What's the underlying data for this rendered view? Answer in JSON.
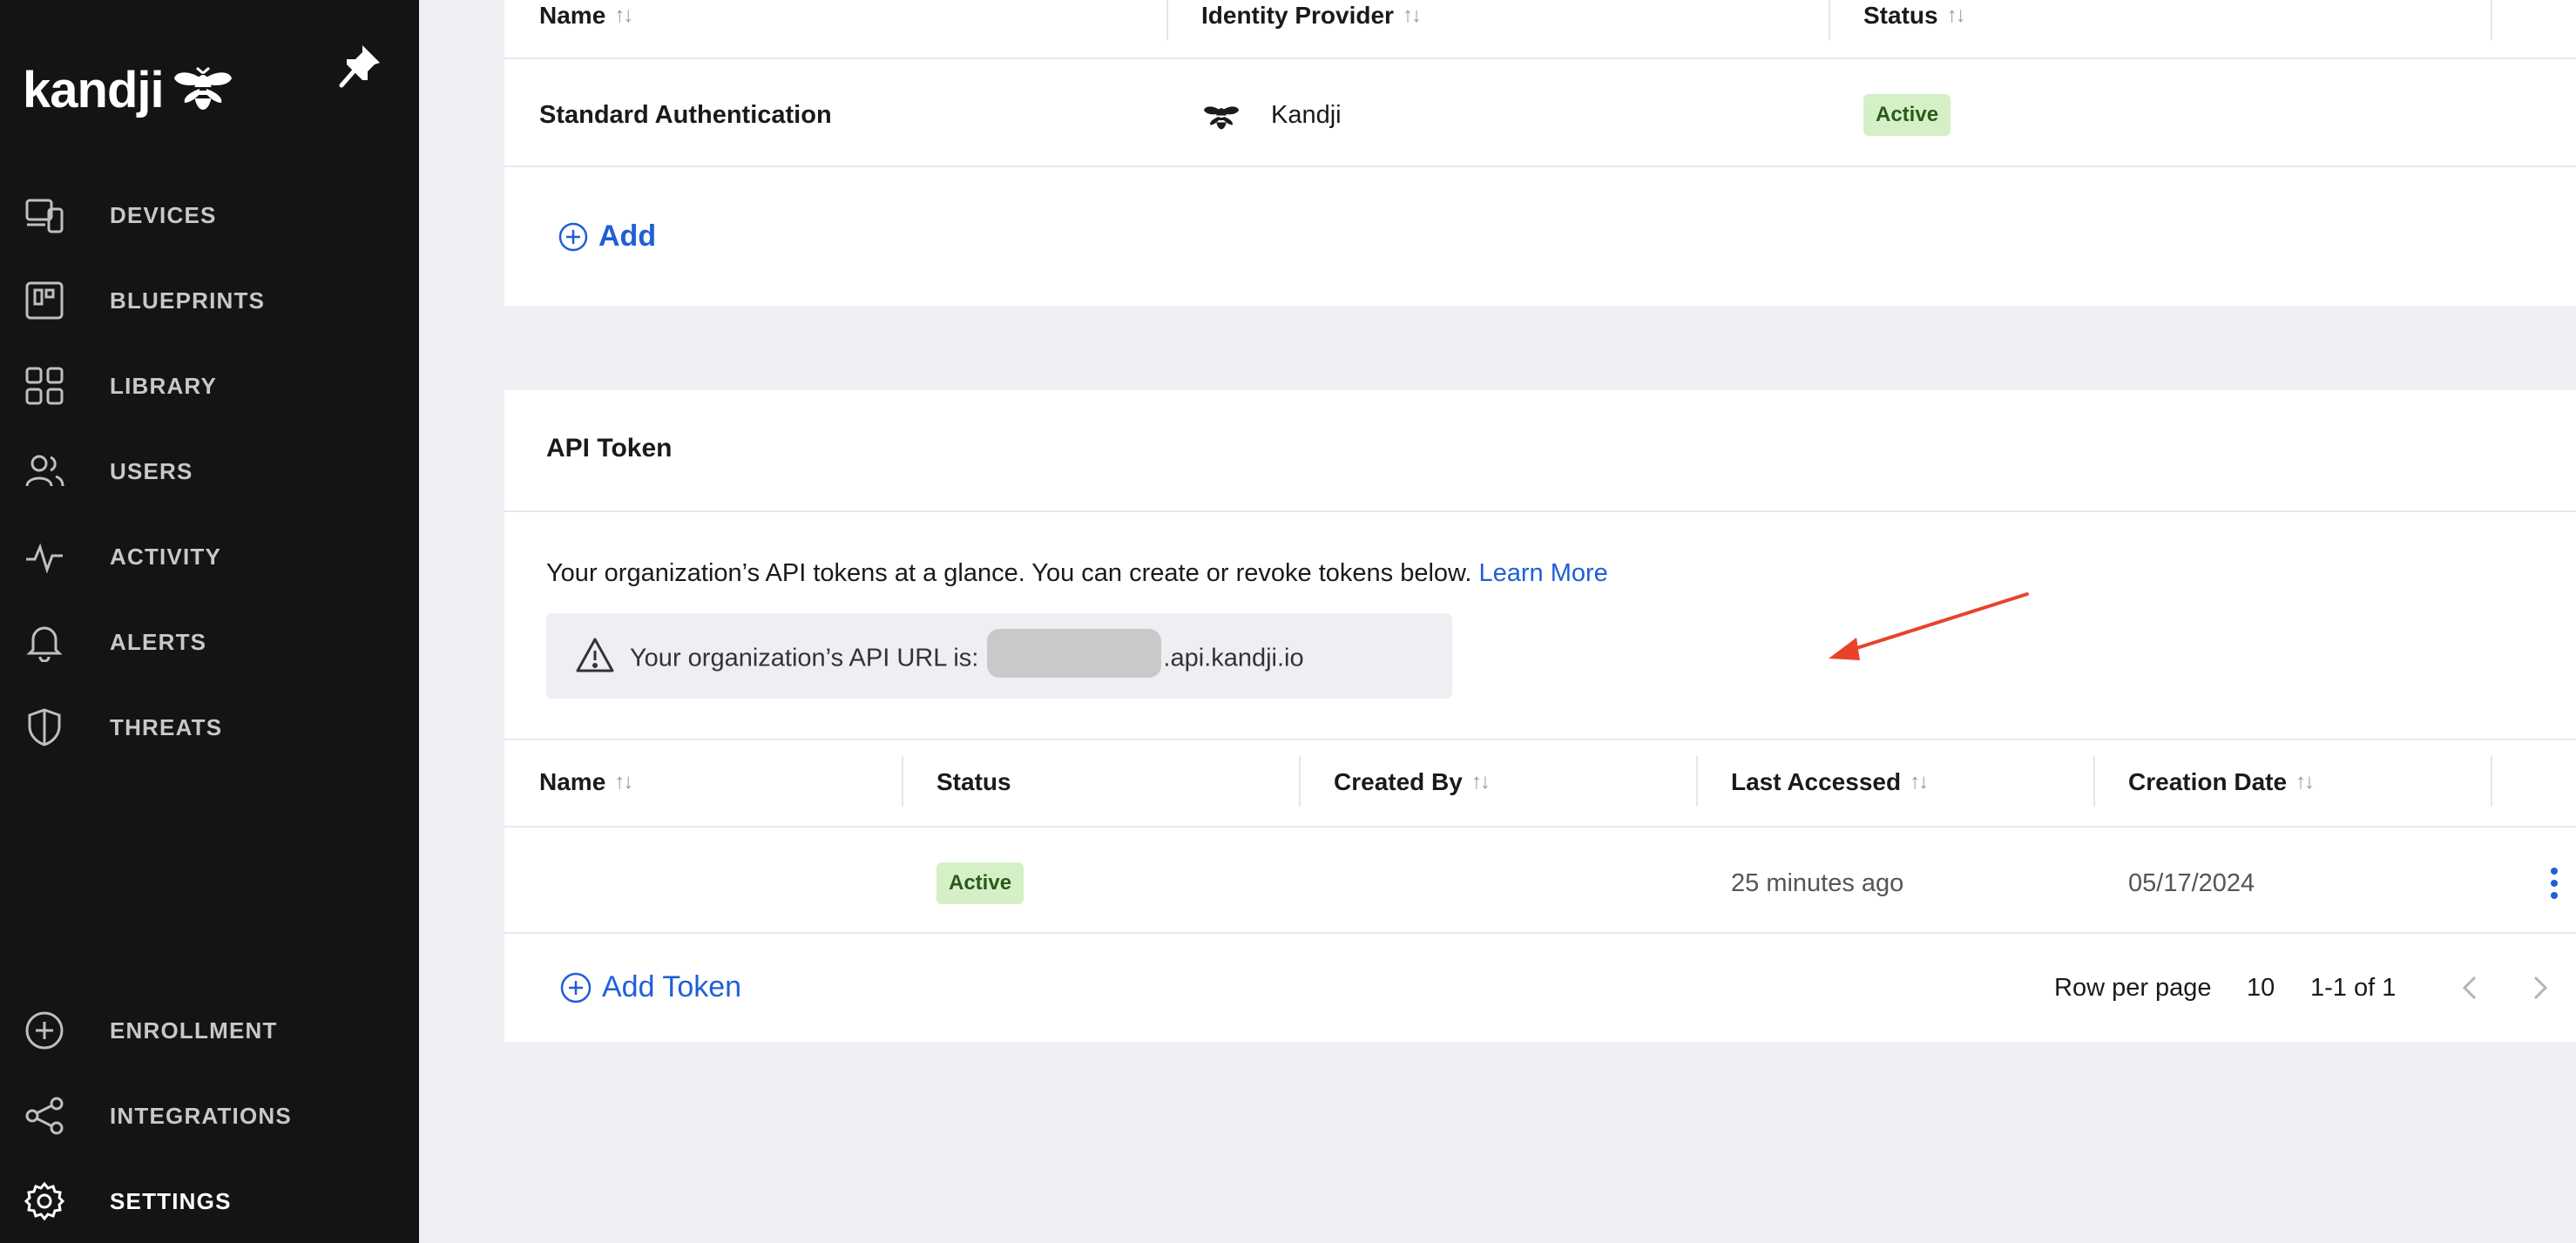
{
  "sidebar": {
    "logo_text": "kandji",
    "pin_icon": "pin-icon",
    "nav": [
      {
        "label": "DEVICES",
        "icon": "devices-icon"
      },
      {
        "label": "BLUEPRINTS",
        "icon": "blueprints-icon"
      },
      {
        "label": "LIBRARY",
        "icon": "library-icon"
      },
      {
        "label": "USERS",
        "icon": "users-icon"
      },
      {
        "label": "ACTIVITY",
        "icon": "activity-icon"
      },
      {
        "label": "ALERTS",
        "icon": "bell-icon"
      },
      {
        "label": "THREATS",
        "icon": "shield-icon"
      }
    ],
    "bottom_nav": [
      {
        "label": "ENROLLMENT",
        "icon": "plus-circle-icon"
      },
      {
        "label": "INTEGRATIONS",
        "icon": "integrations-icon"
      },
      {
        "label": "SETTINGS",
        "icon": "gear-icon",
        "active": true
      }
    ]
  },
  "auth_table": {
    "columns": [
      "Name",
      "Identity Provider",
      "Status"
    ],
    "rows": [
      {
        "name": "Standard Authentication",
        "provider": "Kandji",
        "status": "Active"
      }
    ],
    "add_label": "Add"
  },
  "api_token": {
    "title": "API Token",
    "description": "Your organization’s API tokens at a glance. You can create or revoke tokens below.",
    "learn_more": "Learn More",
    "url_prefix": "Your organization’s API URL is:",
    "url_suffix": ".api.kandji.io",
    "columns": [
      "Name",
      "Status",
      "Created By",
      "Last Accessed",
      "Creation Date"
    ],
    "rows": [
      {
        "name": "",
        "status": "Active",
        "created_by": "",
        "last_accessed": "25 minutes ago",
        "creation_date": "05/17/2024"
      }
    ],
    "add_token_label": "Add Token",
    "rows_per_page_label": "Row per page",
    "rows_per_page_value": "10",
    "range_label": "1-1 of 1"
  },
  "colors": {
    "sidebar_bg": "#141414",
    "accent": "#1f5fd6",
    "badge_bg": "#d5f0c7",
    "arrow": "#e8432a"
  }
}
